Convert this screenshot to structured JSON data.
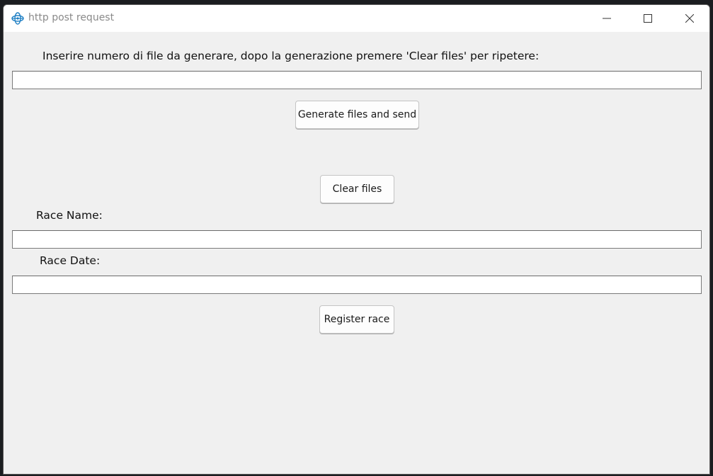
{
  "window": {
    "title": "http post request",
    "icon": "feather-network-icon",
    "controls": {
      "minimize": "minimize-icon",
      "maximize": "maximize-icon",
      "close": "close-icon"
    }
  },
  "form": {
    "num_files_label": "Inserire numero di file da generare, dopo la generazione premere 'Clear files' per ripetere:",
    "num_files_value": "",
    "generate_button": "Generate files and send",
    "clear_button": "Clear files",
    "race_name_label": "Race Name:",
    "race_name_value": "",
    "race_date_label": "Race Date:",
    "race_date_value": "",
    "register_button": "Register race"
  },
  "colors": {
    "window_bg": "#f0f0f0",
    "titlebar_bg": "#ffffff",
    "icon_accent": "#1e7fc4"
  }
}
